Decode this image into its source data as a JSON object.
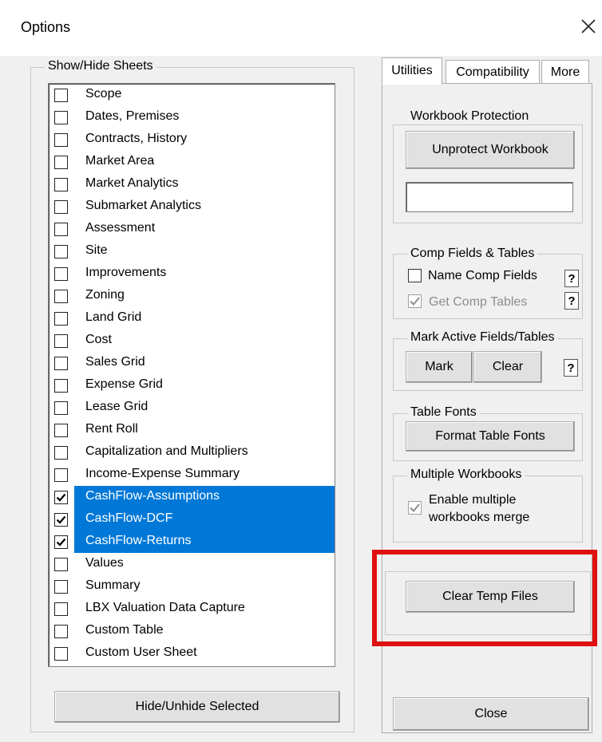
{
  "window": {
    "title": "Options",
    "close_icon": "close-icon"
  },
  "sheets_group": {
    "legend": "Show/Hide Sheets",
    "items": [
      {
        "label": "Scope",
        "checked": false,
        "selected": false
      },
      {
        "label": "Dates, Premises",
        "checked": false,
        "selected": false
      },
      {
        "label": "Contracts, History",
        "checked": false,
        "selected": false
      },
      {
        "label": "Market Area",
        "checked": false,
        "selected": false
      },
      {
        "label": "Market Analytics",
        "checked": false,
        "selected": false
      },
      {
        "label": "Submarket Analytics",
        "checked": false,
        "selected": false
      },
      {
        "label": "Assessment",
        "checked": false,
        "selected": false
      },
      {
        "label": "Site",
        "checked": false,
        "selected": false
      },
      {
        "label": "Improvements",
        "checked": false,
        "selected": false
      },
      {
        "label": "Zoning",
        "checked": false,
        "selected": false
      },
      {
        "label": "Land Grid",
        "checked": false,
        "selected": false
      },
      {
        "label": "Cost",
        "checked": false,
        "selected": false
      },
      {
        "label": "Sales Grid",
        "checked": false,
        "selected": false
      },
      {
        "label": "Expense Grid",
        "checked": false,
        "selected": false
      },
      {
        "label": "Lease Grid",
        "checked": false,
        "selected": false
      },
      {
        "label": "Rent Roll",
        "checked": false,
        "selected": false
      },
      {
        "label": "Capitalization and Multipliers",
        "checked": false,
        "selected": false
      },
      {
        "label": "Income-Expense Summary",
        "checked": false,
        "selected": false
      },
      {
        "label": "CashFlow-Assumptions",
        "checked": true,
        "selected": true
      },
      {
        "label": "CashFlow-DCF",
        "checked": true,
        "selected": true
      },
      {
        "label": "CashFlow-Returns",
        "checked": true,
        "selected": true
      },
      {
        "label": "Values",
        "checked": false,
        "selected": false
      },
      {
        "label": "Summary",
        "checked": false,
        "selected": false
      },
      {
        "label": "LBX Valuation Data Capture",
        "checked": false,
        "selected": false
      },
      {
        "label": "Custom Table",
        "checked": false,
        "selected": false
      },
      {
        "label": "Custom User Sheet",
        "checked": false,
        "selected": false
      }
    ],
    "hide_button": "Hide/Unhide Selected"
  },
  "tabs": [
    {
      "label": "Utilities",
      "active": true
    },
    {
      "label": "Compatibility",
      "active": false
    },
    {
      "label": "More",
      "active": false
    }
  ],
  "utilities": {
    "workbook_protection": {
      "legend": "Workbook Protection",
      "button": "Unprotect Workbook",
      "password_value": ""
    },
    "comp_fields": {
      "legend": "Comp Fields & Tables",
      "name_comp_fields": {
        "label": "Name Comp Fields",
        "checked": false,
        "enabled": true
      },
      "get_comp_tables": {
        "label": "Get Comp Tables",
        "checked": true,
        "enabled": false
      },
      "help": "?"
    },
    "mark_active": {
      "legend": "Mark Active Fields/Tables",
      "mark_button": "Mark",
      "clear_button": "Clear",
      "help": "?"
    },
    "table_fonts": {
      "legend": "Table Fonts",
      "button": "Format Table Fonts"
    },
    "multiple_workbooks": {
      "legend": "Multiple Workbooks",
      "enable_line1": "Enable multiple",
      "enable_line2": "workbooks merge",
      "checked": true,
      "enabled": false
    },
    "clear_temp": {
      "button": "Clear Temp Files"
    },
    "close_button": "Close"
  },
  "colors": {
    "selection": "#0078d7",
    "highlight_frame": "#e01010"
  }
}
